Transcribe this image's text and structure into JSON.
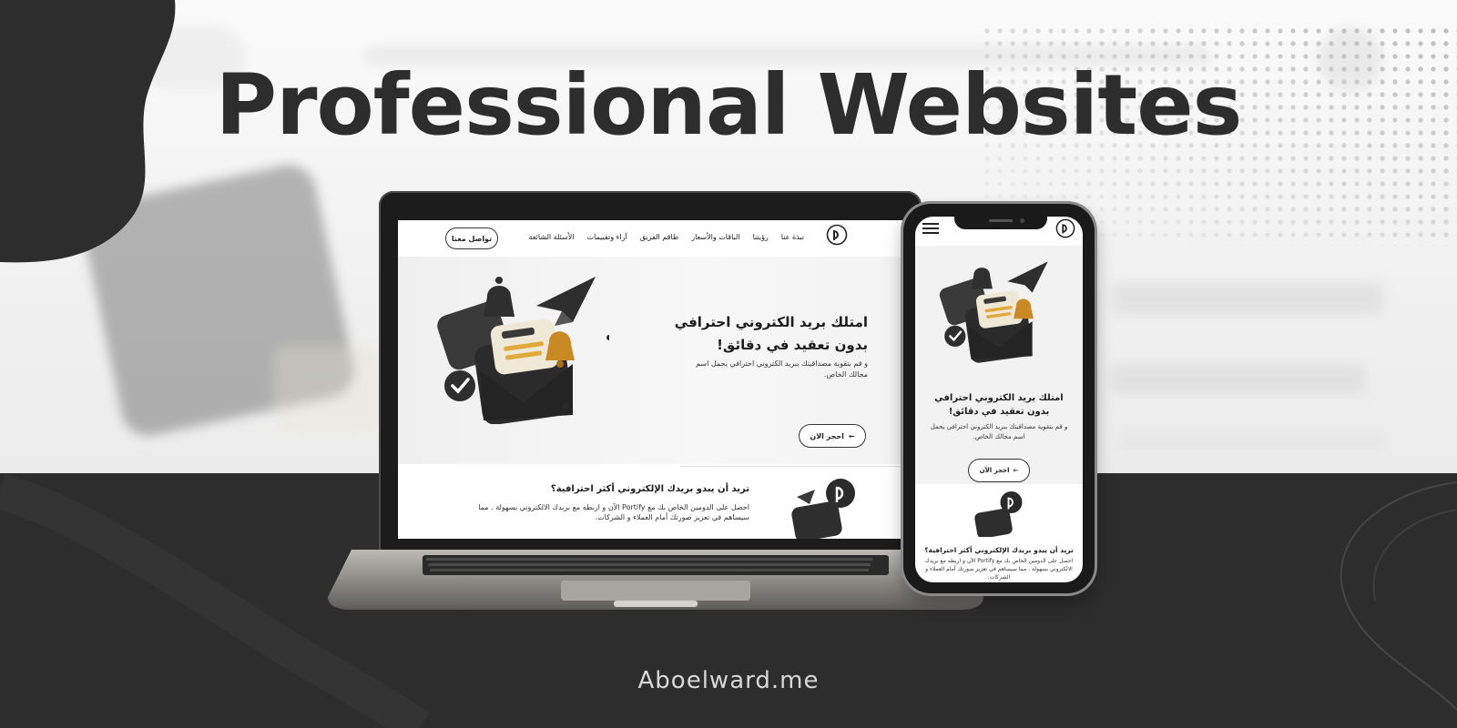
{
  "headline": "Professional Websites",
  "brand": "Aboelward.me",
  "colors": {
    "dark": "#2d2d2d",
    "light": "#f5f5f5",
    "accent": "#e0a93b"
  },
  "site": {
    "nav": {
      "cta": "تواصل معنا",
      "links": [
        "نبذة عنا",
        "رؤيتنا",
        "الباقات والأسعار",
        "طاقم الفريق",
        "آراء وتقييمات",
        "الأسئلة الشائعة"
      ]
    },
    "hero": {
      "title": "امتلك بريد الكتروني احترافي بدون تعقيد في دقائق!",
      "subtitle": "و قم بتقوية مصداقيتك ببريد الكتروني احترافي يحمل اسم مجالك الخاص.",
      "button": "احجز الان",
      "illustration": "mail-envelope-bell-plane-illustration"
    },
    "section2": {
      "title": "تريد أن يبدو بريدك الإلكتروني أكثر احترافية؟",
      "body": "احصل على الدومين الخاص بك مع Portify الآن و اربطه مع بريدك الالكتروني بسهولة . مما سيساهم في تعزيز صورتك أمام العملاء و الشركات."
    }
  },
  "mobile": {
    "hero_title": "امتلك بريد الكتروني احترافي بدون تعقيد في دقائق!",
    "hero_subtitle": "و قم بتقوية مصداقيتك ببريد الكتروني احترافي يحمل اسم مجالك الخاص.",
    "hero_button": "احجز الآن",
    "section2_title": "تريد أن يبدو بريدك الإلكتروني أكثر احترافية؟",
    "section2_body": "احصل على الدومين الخاص بك مع Portify الآن و اربطه مع بريدك الالكتروني بسهولة . مما سيساهم في تعزيز صورتك أمام العملاء و الشركات."
  }
}
